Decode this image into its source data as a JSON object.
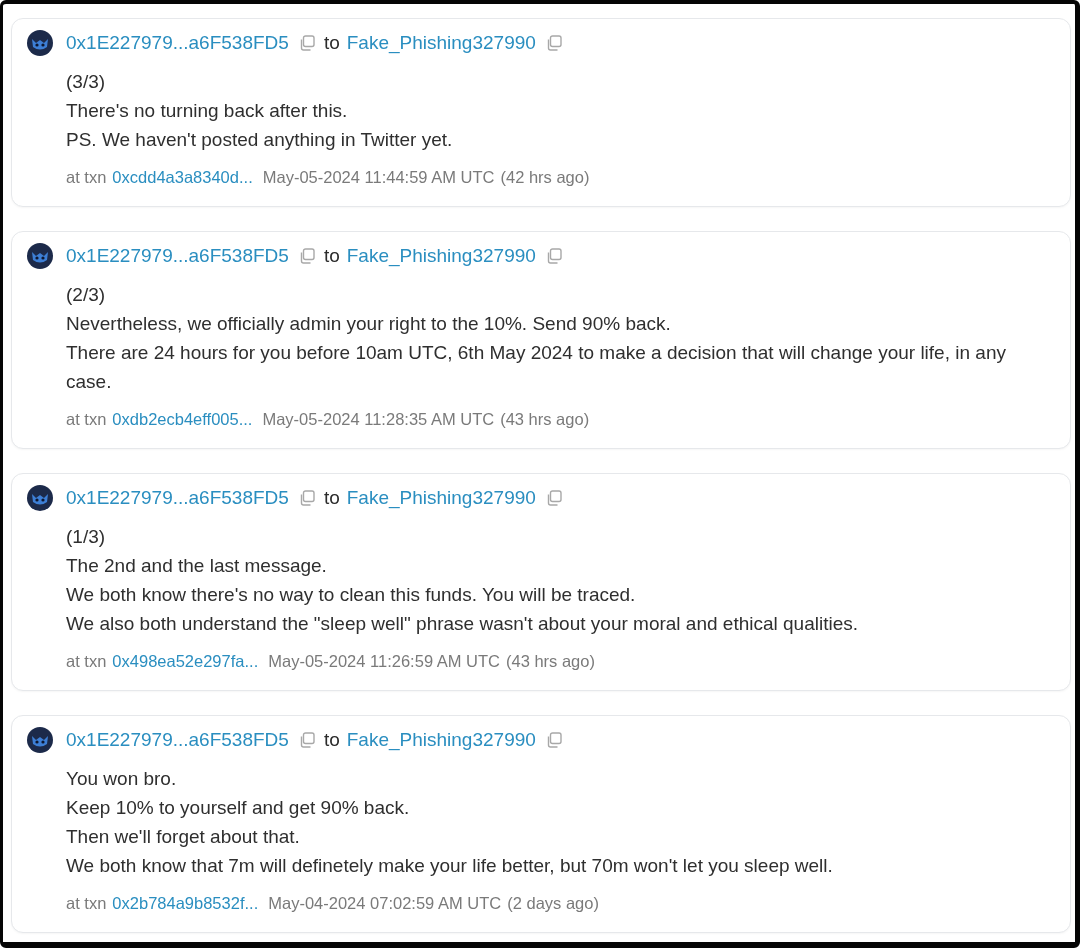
{
  "messages": [
    {
      "sender": "0x1E227979...a6F538FD5",
      "to": "to",
      "recipient": "Fake_Phishing327990",
      "lines": [
        "(3/3)",
        "There's no turning back after this.",
        "PS. We haven't posted anything in Twitter yet."
      ],
      "txn_label": "at txn",
      "txn": "0xcdd4a3a8340d...",
      "time": "May-05-2024 11:44:59 AM UTC",
      "age": "(42 hrs ago)"
    },
    {
      "sender": "0x1E227979...a6F538FD5",
      "to": "to",
      "recipient": "Fake_Phishing327990",
      "lines": [
        "(2/3)",
        "Nevertheless, we officially admin your right to the 10%. Send 90% back.",
        "There are 24 hours for you before 10am UTC, 6th May 2024 to make a decision that will change your life, in any case."
      ],
      "txn_label": "at txn",
      "txn": "0xdb2ecb4eff005...",
      "time": "May-05-2024 11:28:35 AM UTC",
      "age": "(43 hrs ago)"
    },
    {
      "sender": "0x1E227979...a6F538FD5",
      "to": "to",
      "recipient": "Fake_Phishing327990",
      "lines": [
        "(1/3)",
        "The 2nd and the last message.",
        "We both know there's no way to clean this funds. You will be traced.",
        "We also both understand the \"sleep well\" phrase wasn't about your moral and ethical qualities."
      ],
      "txn_label": "at txn",
      "txn": "0x498ea52e297fa...",
      "time": "May-05-2024 11:26:59 AM UTC",
      "age": "(43 hrs ago)"
    },
    {
      "sender": "0x1E227979...a6F538FD5",
      "to": "to",
      "recipient": "Fake_Phishing327990",
      "lines": [
        "You won bro.",
        "Keep 10% to yourself and get 90% back.",
        "Then we'll forget about that.",
        "We both know that 7m will definetely make your life better, but 70m won't let you sleep well."
      ],
      "txn_label": "at txn",
      "txn": "0x2b784a9b8532f...",
      "time": "May-04-2024 07:02:59 AM UTC",
      "age": "(2 days ago)"
    }
  ]
}
